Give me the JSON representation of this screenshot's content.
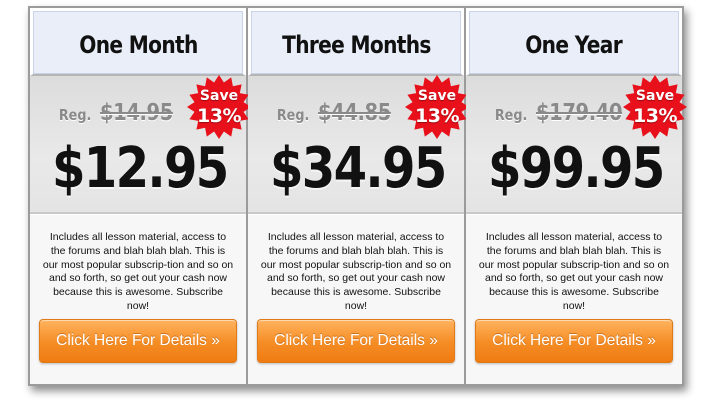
{
  "plans": [
    {
      "name": "One Month",
      "reg_label": "Reg.",
      "reg_price": "$14.95",
      "price": "$12.95",
      "save_label": "Save",
      "save_percent": "13%",
      "description": "Includes all lesson material, access to the forums and blah blah blah. This is our most popular subscrip-tion and so on and so forth, so get out your cash now because this is awesome.  Subscribe now!",
      "cta_label": "Click Here For Details »"
    },
    {
      "name": "Three Months",
      "reg_label": "Reg.",
      "reg_price": "$44.85",
      "price": "$34.95",
      "save_label": "Save",
      "save_percent": "13%",
      "description": "Includes all lesson material, access to the forums and blah blah blah. This is our most popular subscrip-tion and so on and so forth, so get out your cash now because this is awesome.  Subscribe now!",
      "cta_label": "Click Here For Details »"
    },
    {
      "name": "One Year",
      "reg_label": "Reg.",
      "reg_price": "$179.40",
      "price": "$99.95",
      "save_label": "Save",
      "save_percent": "13%",
      "description": "Includes all lesson material, access to the forums and blah blah blah. This is our most popular subscrip-tion and so on and so forth, so get out your cash now because this is awesome.  Subscribe now!",
      "cta_label": "Click Here For Details »"
    }
  ],
  "colors": {
    "badge_red": "#e8101a",
    "button_orange": "#f58c24",
    "header_blue": "#e9eef8"
  }
}
